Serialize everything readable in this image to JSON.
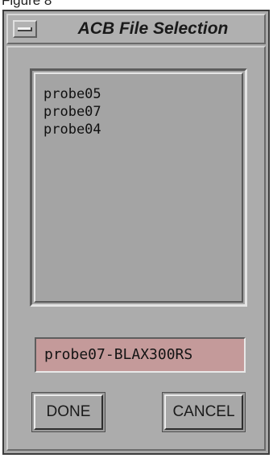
{
  "caption": "Figure 8",
  "window": {
    "title": "ACB File Selection",
    "menu_icon": "window-menu-icon"
  },
  "file_list": {
    "items": [
      {
        "label": "probe05"
      },
      {
        "label": "probe07"
      },
      {
        "label": "probe04"
      }
    ]
  },
  "selection_field": {
    "value": "probe07-BLAX300RS"
  },
  "buttons": {
    "done_label": "DONE",
    "cancel_label": "CANCEL"
  },
  "colors": {
    "window_bg": "#acacac",
    "selection_field_bg": "#c49a9a"
  }
}
